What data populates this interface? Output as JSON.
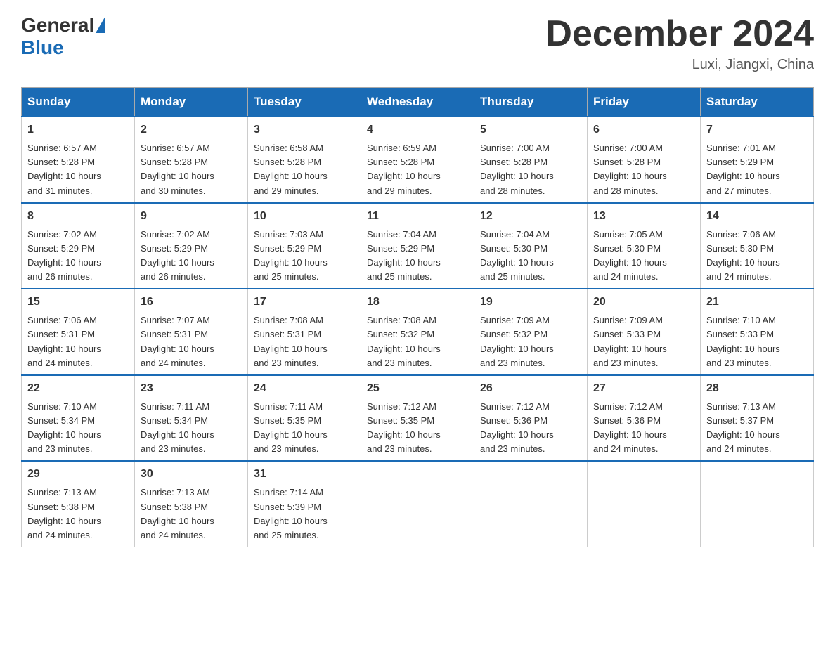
{
  "header": {
    "logo": {
      "general": "General",
      "blue": "Blue"
    },
    "title": "December 2024",
    "subtitle": "Luxi, Jiangxi, China"
  },
  "weekdays": [
    "Sunday",
    "Monday",
    "Tuesday",
    "Wednesday",
    "Thursday",
    "Friday",
    "Saturday"
  ],
  "weeks": [
    [
      {
        "day": "1",
        "sunrise": "6:57 AM",
        "sunset": "5:28 PM",
        "daylight": "10 hours and 31 minutes."
      },
      {
        "day": "2",
        "sunrise": "6:57 AM",
        "sunset": "5:28 PM",
        "daylight": "10 hours and 30 minutes."
      },
      {
        "day": "3",
        "sunrise": "6:58 AM",
        "sunset": "5:28 PM",
        "daylight": "10 hours and 29 minutes."
      },
      {
        "day": "4",
        "sunrise": "6:59 AM",
        "sunset": "5:28 PM",
        "daylight": "10 hours and 29 minutes."
      },
      {
        "day": "5",
        "sunrise": "7:00 AM",
        "sunset": "5:28 PM",
        "daylight": "10 hours and 28 minutes."
      },
      {
        "day": "6",
        "sunrise": "7:00 AM",
        "sunset": "5:28 PM",
        "daylight": "10 hours and 28 minutes."
      },
      {
        "day": "7",
        "sunrise": "7:01 AM",
        "sunset": "5:29 PM",
        "daylight": "10 hours and 27 minutes."
      }
    ],
    [
      {
        "day": "8",
        "sunrise": "7:02 AM",
        "sunset": "5:29 PM",
        "daylight": "10 hours and 26 minutes."
      },
      {
        "day": "9",
        "sunrise": "7:02 AM",
        "sunset": "5:29 PM",
        "daylight": "10 hours and 26 minutes."
      },
      {
        "day": "10",
        "sunrise": "7:03 AM",
        "sunset": "5:29 PM",
        "daylight": "10 hours and 25 minutes."
      },
      {
        "day": "11",
        "sunrise": "7:04 AM",
        "sunset": "5:29 PM",
        "daylight": "10 hours and 25 minutes."
      },
      {
        "day": "12",
        "sunrise": "7:04 AM",
        "sunset": "5:30 PM",
        "daylight": "10 hours and 25 minutes."
      },
      {
        "day": "13",
        "sunrise": "7:05 AM",
        "sunset": "5:30 PM",
        "daylight": "10 hours and 24 minutes."
      },
      {
        "day": "14",
        "sunrise": "7:06 AM",
        "sunset": "5:30 PM",
        "daylight": "10 hours and 24 minutes."
      }
    ],
    [
      {
        "day": "15",
        "sunrise": "7:06 AM",
        "sunset": "5:31 PM",
        "daylight": "10 hours and 24 minutes."
      },
      {
        "day": "16",
        "sunrise": "7:07 AM",
        "sunset": "5:31 PM",
        "daylight": "10 hours and 24 minutes."
      },
      {
        "day": "17",
        "sunrise": "7:08 AM",
        "sunset": "5:31 PM",
        "daylight": "10 hours and 23 minutes."
      },
      {
        "day": "18",
        "sunrise": "7:08 AM",
        "sunset": "5:32 PM",
        "daylight": "10 hours and 23 minutes."
      },
      {
        "day": "19",
        "sunrise": "7:09 AM",
        "sunset": "5:32 PM",
        "daylight": "10 hours and 23 minutes."
      },
      {
        "day": "20",
        "sunrise": "7:09 AM",
        "sunset": "5:33 PM",
        "daylight": "10 hours and 23 minutes."
      },
      {
        "day": "21",
        "sunrise": "7:10 AM",
        "sunset": "5:33 PM",
        "daylight": "10 hours and 23 minutes."
      }
    ],
    [
      {
        "day": "22",
        "sunrise": "7:10 AM",
        "sunset": "5:34 PM",
        "daylight": "10 hours and 23 minutes."
      },
      {
        "day": "23",
        "sunrise": "7:11 AM",
        "sunset": "5:34 PM",
        "daylight": "10 hours and 23 minutes."
      },
      {
        "day": "24",
        "sunrise": "7:11 AM",
        "sunset": "5:35 PM",
        "daylight": "10 hours and 23 minutes."
      },
      {
        "day": "25",
        "sunrise": "7:12 AM",
        "sunset": "5:35 PM",
        "daylight": "10 hours and 23 minutes."
      },
      {
        "day": "26",
        "sunrise": "7:12 AM",
        "sunset": "5:36 PM",
        "daylight": "10 hours and 23 minutes."
      },
      {
        "day": "27",
        "sunrise": "7:12 AM",
        "sunset": "5:36 PM",
        "daylight": "10 hours and 24 minutes."
      },
      {
        "day": "28",
        "sunrise": "7:13 AM",
        "sunset": "5:37 PM",
        "daylight": "10 hours and 24 minutes."
      }
    ],
    [
      {
        "day": "29",
        "sunrise": "7:13 AM",
        "sunset": "5:38 PM",
        "daylight": "10 hours and 24 minutes."
      },
      {
        "day": "30",
        "sunrise": "7:13 AM",
        "sunset": "5:38 PM",
        "daylight": "10 hours and 24 minutes."
      },
      {
        "day": "31",
        "sunrise": "7:14 AM",
        "sunset": "5:39 PM",
        "daylight": "10 hours and 25 minutes."
      },
      null,
      null,
      null,
      null
    ]
  ],
  "labels": {
    "sunrise": "Sunrise:",
    "sunset": "Sunset:",
    "daylight": "Daylight:"
  }
}
